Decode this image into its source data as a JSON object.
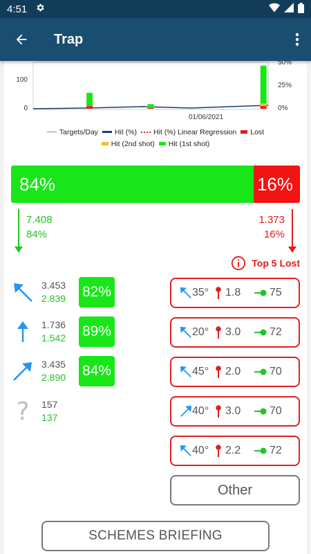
{
  "status": {
    "time": "4:51"
  },
  "app_bar": {
    "title": "Trap"
  },
  "chart_data": {
    "type": "bar",
    "x_tick_labels": [
      "01/06/2021"
    ],
    "y_left_ticks": [
      "100",
      "0"
    ],
    "y_right_ticks": [
      "50%",
      "25%",
      "0%"
    ],
    "series": [
      {
        "name": "Targets/Day",
        "color": "#888888"
      },
      {
        "name": "Hit (%)",
        "color": "#1a3d6e"
      },
      {
        "name": "Hit (%) Linear Regression",
        "color": "#e41a1a"
      },
      {
        "name": "Lost",
        "color": "#e41a1a"
      },
      {
        "name": "Hit (2nd shot)",
        "color": "#f5c021"
      },
      {
        "name": "Hit (1st shot)",
        "color": "#19e619"
      }
    ],
    "bars": [
      {
        "x": 0.24,
        "hit_1st": 20,
        "hit_2nd": 0,
        "lost": 4
      },
      {
        "x": 0.5,
        "hit_1st": 6,
        "hit_2nd": 0,
        "lost": 1
      },
      {
        "x": 0.98,
        "hit_1st": 57,
        "hit_2nd": 4,
        "lost": 4
      }
    ]
  },
  "summary": {
    "hit_pct": 84,
    "hit_label": "84%",
    "lost_label": "16%",
    "hit_count": "7.408",
    "hit_count_pct": "84%",
    "lost_count": "1.373",
    "lost_count_pct": "16%"
  },
  "top_lost_title": "Top 5 Lost",
  "directions": [
    {
      "icon": "arrow-up-left-icon",
      "total": "3.453",
      "hits": "2.839",
      "pct": "82%"
    },
    {
      "icon": "arrow-up-icon",
      "total": "1.736",
      "hits": "1.542",
      "pct": "89%"
    },
    {
      "icon": "arrow-up-right-icon",
      "total": "3.435",
      "hits": "2.890",
      "pct": "84%"
    },
    {
      "icon": "question-icon",
      "total": "157",
      "hits": "137",
      "pct": ""
    }
  ],
  "top_lost": [
    {
      "dir": "up-left",
      "angle": "35°",
      "height": "1.8",
      "distance": "75"
    },
    {
      "dir": "up-left",
      "angle": "20°",
      "height": "3.0",
      "distance": "72"
    },
    {
      "dir": "up-left",
      "angle": "45°",
      "height": "2.0",
      "distance": "70"
    },
    {
      "dir": "up-right",
      "angle": "40°",
      "height": "3.0",
      "distance": "70"
    },
    {
      "dir": "up-left",
      "angle": "40°",
      "height": "2.2",
      "distance": "72"
    }
  ],
  "buttons": {
    "other": "Other",
    "briefing": "SCHEMES BRIEFING"
  },
  "colors": {
    "hit": "#19e619",
    "lost": "#f21313",
    "app_bar": "#1a4e70",
    "status_bar": "#123d59",
    "arrow_blue": "#2196f3"
  }
}
